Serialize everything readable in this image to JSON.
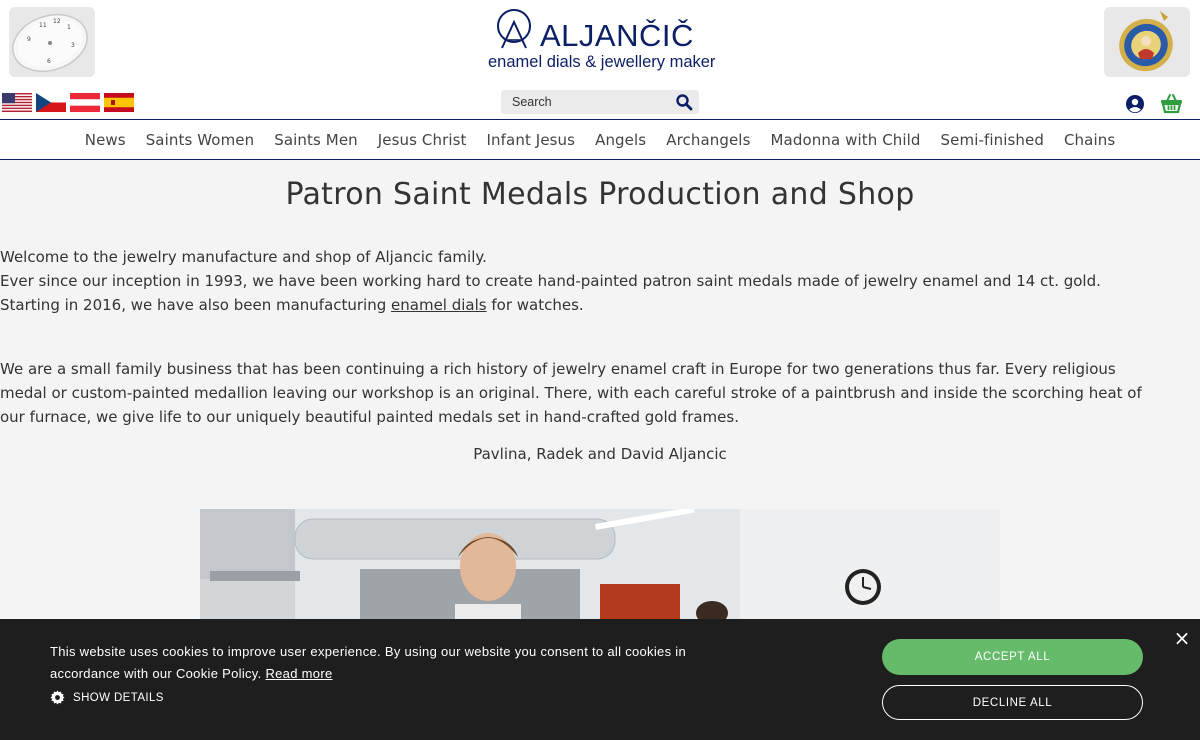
{
  "brand": {
    "name": "ALJANČIČ",
    "tagline": "enamel dials & jewellery maker",
    "color": "#0c1e66"
  },
  "languages": [
    {
      "icon": "flag-usa-icon"
    },
    {
      "icon": "flag-czech-icon"
    },
    {
      "icon": "flag-austria-icon"
    },
    {
      "icon": "flag-spain-icon"
    }
  ],
  "search": {
    "placeholder": "Search",
    "icon": "search-icon"
  },
  "account_icon": "user-circle-icon",
  "cart_icon": "basket-icon",
  "nav": [
    "News",
    "Saints Women",
    "Saints Men",
    "Jesus Christ",
    "Infant Jesus",
    "Angels",
    "Archangels",
    "Madonna with Child",
    "Semi-finished",
    "Chains"
  ],
  "main": {
    "title": "Patron Saint Medals Production and Shop",
    "intro_line1": "Welcome to the jewelry manufacture and shop of Aljancic family.",
    "intro_line2": "Ever since our inception in 1993, we have been working hard to create hand-painted patron saint medals made of jewelry enamel and 14 ct. gold.",
    "intro_line3_before": "Starting in 2016, we have also been manufacturing ",
    "intro_line3_link": "enamel dials",
    "intro_line3_after": " for watches.",
    "para2_line1": "We are a small family business that has been continuing a rich history of jewelry enamel craft in Europe for two generations thus far. Every religious",
    "para2_line2": "medal or custom-painted medallion leaving our workshop is an original. There, with each careful stroke of a paintbrush and inside the scorching heat of",
    "para2_line3": "our furnace, we give life to our uniquely beautiful painted medals set in hand-crafted gold frames.",
    "signature": "Pavlina, Radek and David Aljancic"
  },
  "cookie": {
    "text_line1": "This website uses cookies to improve user experience. By using our website you consent to all cookies in",
    "text_line2": "accordance with our Cookie Policy. ",
    "read_more": "Read more",
    "show_details": "SHOW DETAILS",
    "accept": "ACCEPT ALL",
    "decline": "DECLINE ALL",
    "close": "×",
    "accept_color": "#66bb6a",
    "background": "#1e1e1e"
  }
}
